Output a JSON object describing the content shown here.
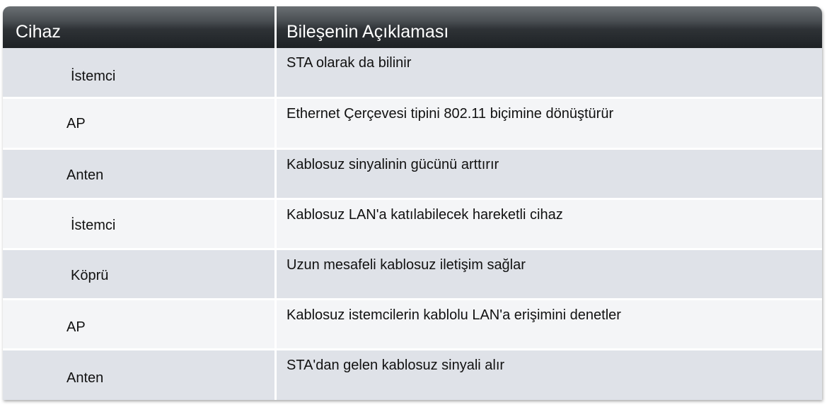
{
  "header": {
    "device": "Cihaz",
    "description": "Bileşenin Açıklaması"
  },
  "rows": [
    {
      "device": "İstemci",
      "description": "STA olarak da bilinir"
    },
    {
      "device": "AP",
      "description": "Ethernet Çerçevesi tipini 802.11 biçimine dönüştürür"
    },
    {
      "device": "Anten",
      "description": "Kablosuz sinyalinin gücünü arttırır"
    },
    {
      "device": "İstemci",
      "description": "Kablosuz LAN'a katılabilecek hareketli cihaz"
    },
    {
      "device": "Köprü",
      "description": "Uzun mesafeli kablosuz iletişim sağlar"
    },
    {
      "device": "AP",
      "description": "Kablosuz istemcilerin kablolu LAN'a erişimini denetler"
    },
    {
      "device": "Anten",
      "description": "STA'dan gelen kablosuz sinyali alır"
    }
  ]
}
